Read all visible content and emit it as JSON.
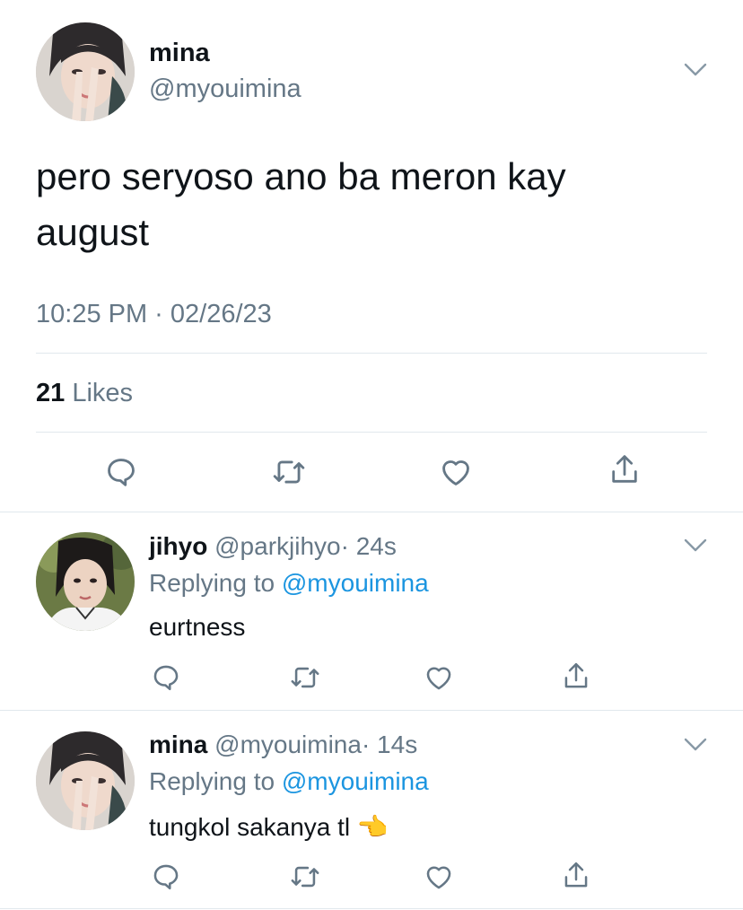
{
  "main_tweet": {
    "author_name": "mina",
    "author_handle": "@myouimina",
    "text_line1": "pero seryoso ano ba meron kay",
    "text_line2": "august",
    "timestamp": "10:25 PM · 02/26/23",
    "likes_count": "21",
    "likes_label": "Likes"
  },
  "replies": [
    {
      "author_name": "jihyo",
      "author_handle": "@parkjihyo",
      "time": "· 24s",
      "replying_prefix": "Replying to",
      "replying_to": "@myouimina",
      "text": "eurtness"
    },
    {
      "author_name": "mina",
      "author_handle": "@myouimina",
      "time": "· 14s",
      "replying_prefix": "Replying to",
      "replying_to": "@myouimina",
      "text": "tungkol sakanya tl",
      "emoji": "👈"
    }
  ],
  "colors": {
    "text": "#0f1419",
    "secondary": "#657786",
    "link": "#1b95e0",
    "divider": "#e1e8ed"
  },
  "icons": [
    "reply-icon",
    "retweet-icon",
    "like-icon",
    "share-icon",
    "chevron-down-icon"
  ]
}
